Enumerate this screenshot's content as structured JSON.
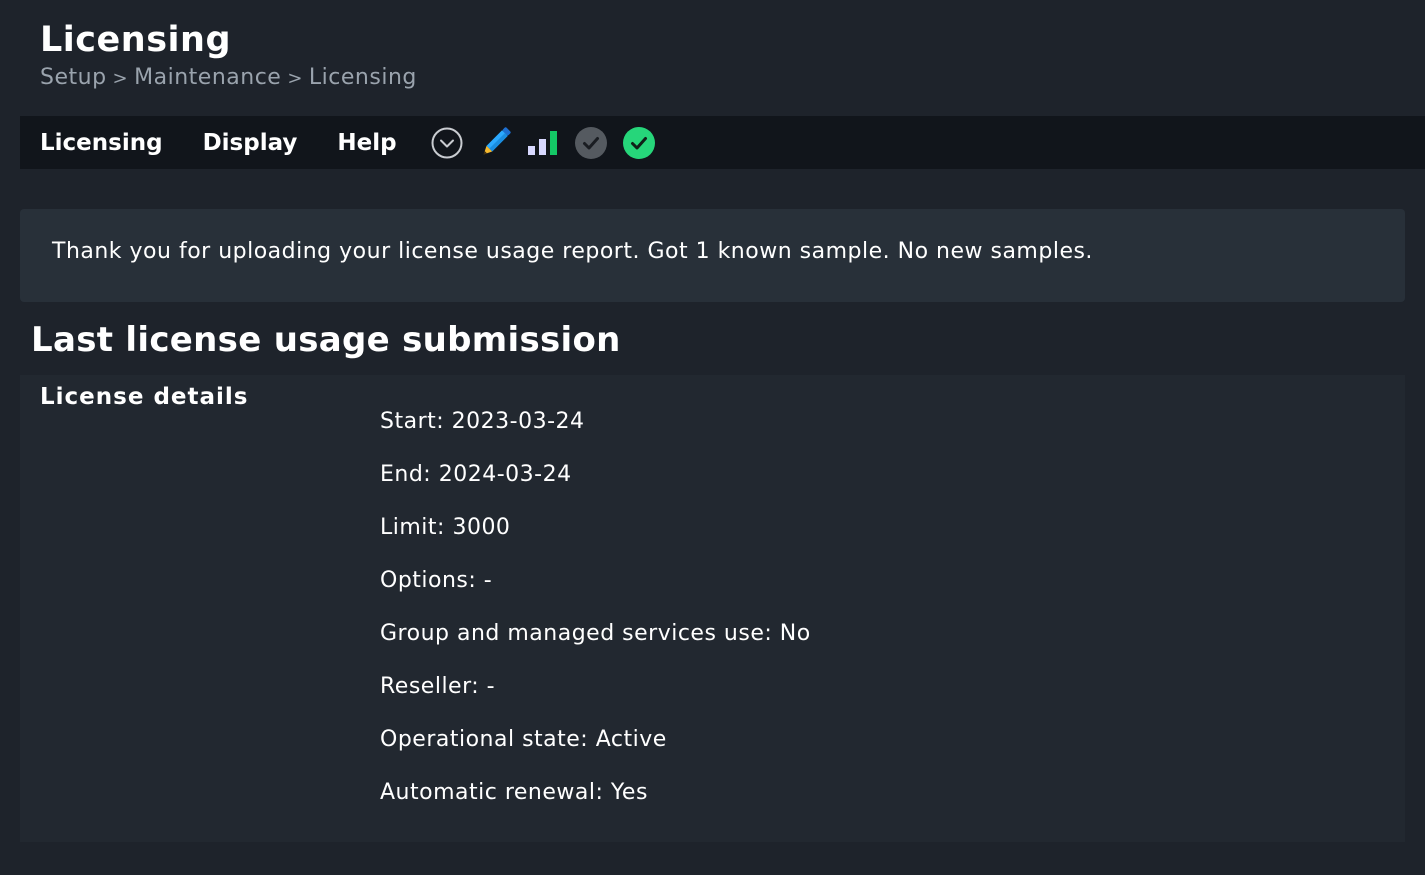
{
  "header": {
    "title": "Licensing",
    "breadcrumb": [
      "Setup",
      "Maintenance",
      "Licensing"
    ],
    "breadcrumb_separator": ">"
  },
  "menubar": {
    "items": [
      "Licensing",
      "Display",
      "Help"
    ],
    "icons": [
      {
        "name": "chevron-down-circle-icon"
      },
      {
        "name": "pencil-icon",
        "colors": [
          "#2ba9ff",
          "#f5b82e"
        ]
      },
      {
        "name": "bar-chart-icon",
        "colors": [
          "#d8d8ff",
          "#14c866"
        ]
      },
      {
        "name": "check-circle-gray-icon",
        "color": "#555a60"
      },
      {
        "name": "check-circle-green-icon",
        "color": "#26d67a"
      }
    ]
  },
  "message": {
    "text": "Thank you for uploading your license usage report. Got 1 known sample. No new samples."
  },
  "section": {
    "heading": "Last license usage submission",
    "details_label": "License details",
    "details": [
      "Start: 2023-03-24",
      "End: 2024-03-24",
      "Limit: 3000",
      "Options: -",
      "Group and managed services use: No",
      "Reseller: -",
      "Operational state: Active",
      "Automatic renewal: Yes"
    ]
  },
  "colors": {
    "background": "#1e232b",
    "menubar": "#11151b",
    "message_background": "#283039",
    "details_background": "#222830",
    "breadcrumb_text": "#9aa3ad",
    "accent_green": "#26d67a"
  }
}
